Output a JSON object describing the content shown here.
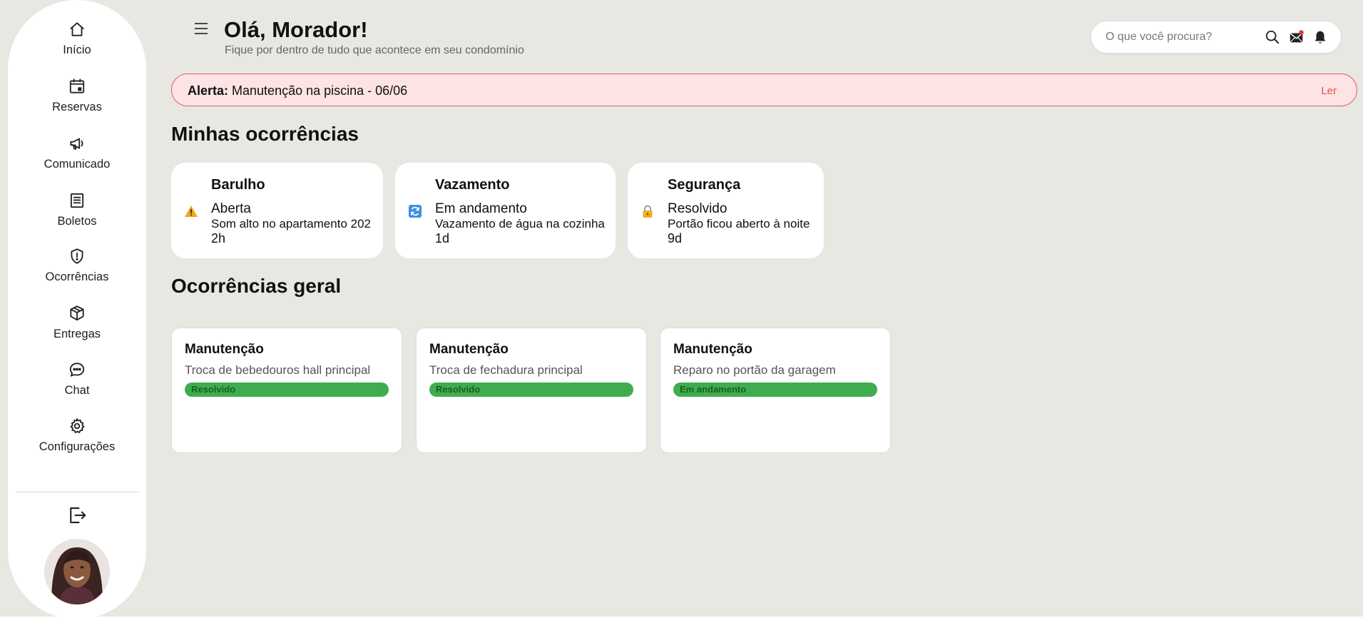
{
  "sidebar": {
    "items": [
      {
        "label": "Início",
        "icon": "home-icon"
      },
      {
        "label": "Reservas",
        "icon": "calendar-icon"
      },
      {
        "label": "Comunicado",
        "icon": "megaphone-icon"
      },
      {
        "label": "Boletos",
        "icon": "receipt-icon"
      },
      {
        "label": "Ocorrências",
        "icon": "shield-alert-icon"
      },
      {
        "label": "Entregas",
        "icon": "package-icon"
      },
      {
        "label": "Chat",
        "icon": "chat-bubble-icon"
      },
      {
        "label": "Configurações",
        "icon": "gear-icon"
      }
    ],
    "logout_icon": "logout-icon"
  },
  "header": {
    "greeting": "Olá, Morador!",
    "subtitle": "Fique por dentro de tudo que acontece em seu condomínio",
    "search_placeholder": "O que você procura?",
    "icons": [
      "search-icon",
      "mail-icon",
      "bell-icon"
    ]
  },
  "alert": {
    "prefix": "Alerta:",
    "message": "Manutenção na piscina - 06/06",
    "action": "Ler",
    "border_color": "#e0606a",
    "background_color": "#fde3e3"
  },
  "my_occurrences": {
    "title": "Minhas ocorrências",
    "cards": [
      {
        "title": "Barulho",
        "status": "Aberta",
        "description": "Som alto no apartamento 202",
        "time": "2h",
        "icon": "warning-icon"
      },
      {
        "title": "Vazamento",
        "status": "Em andamento",
        "description": "Vazamento de água na cozinha",
        "time": "1d",
        "icon": "refresh-icon"
      },
      {
        "title": "Segurança",
        "status": "Resolvido",
        "description": "Portão ficou aberto à noite",
        "time": "9d",
        "icon": "lock-icon"
      }
    ]
  },
  "general_occurrences": {
    "title": "Ocorrências geral",
    "cards": [
      {
        "title": "Manutenção",
        "description": "Troca de bebedouros hall principal",
        "status": "Resolvido"
      },
      {
        "title": "Manutenção",
        "description": "Troca de fechadura principal",
        "status": "Resolvido"
      },
      {
        "title": "Manutenção",
        "description": "Reparo no portão da garagem",
        "status": "Em andamento"
      }
    ],
    "badge_color": "#3fad4d"
  }
}
